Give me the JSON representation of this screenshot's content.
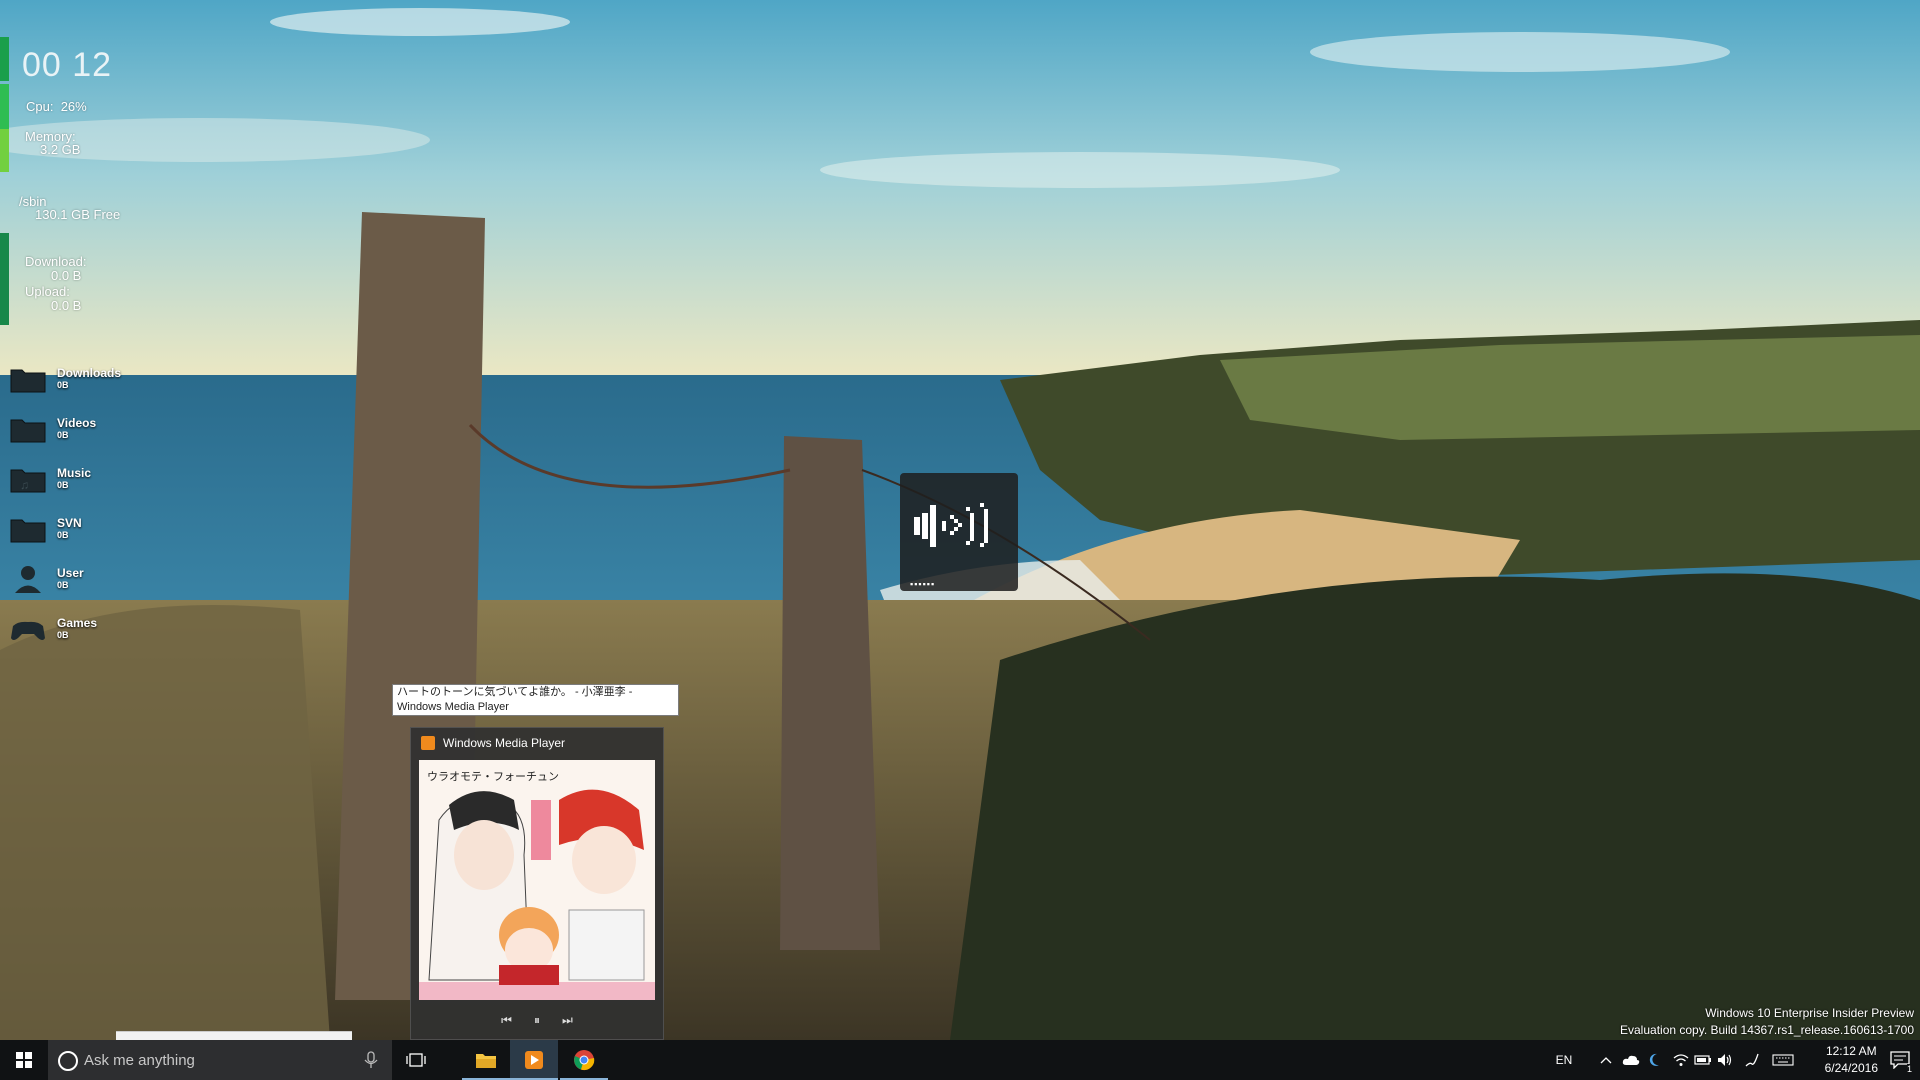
{
  "system": {
    "clock": "00 12",
    "cpu_label": "Cpu:",
    "cpu_value": "26%",
    "memory_label": "Memory:",
    "memory_value": "3.2 GB",
    "disk_label": "/sbin",
    "disk_value": "130.1 GB Free",
    "download_label": "Download:",
    "download_value": "0.0 B",
    "upload_label": "Upload:",
    "upload_value": "0.0 B",
    "accent_colors": [
      "#1a9f4b",
      "#2fbd52",
      "#72d03f"
    ]
  },
  "folders": [
    {
      "label": "Downloads",
      "size": "0B",
      "icon": "folder-icon"
    },
    {
      "label": "Videos",
      "size": "0B",
      "icon": "folder-icon"
    },
    {
      "label": "Music",
      "size": "0B",
      "icon": "folder-icon"
    },
    {
      "label": "SVN",
      "size": "0B",
      "icon": "folder-icon"
    },
    {
      "label": "User",
      "size": "0B",
      "icon": "user-icon"
    },
    {
      "label": "Games",
      "size": "0B",
      "icon": "gamepad-icon"
    }
  ],
  "volume_osd": {
    "icon": "speaker-volume-icon",
    "level_glyph": "▪▪▪▪▪▪"
  },
  "tooltip": {
    "text": "ハートのトーンに気づいてよ誰か。 - 小澤亜李 - Windows Media Player"
  },
  "media_flyout": {
    "title": "Windows Media Player",
    "album_title": "ウラオモテ・フォーチュン",
    "controls": {
      "previous": "⏮",
      "pause": "⏸",
      "next": "⏭"
    }
  },
  "watermark": {
    "line1": "Windows 10 Enterprise Insider Preview",
    "line2": "Evaluation copy. Build 14367.rs1_release.160613-1700"
  },
  "taskbar": {
    "search_placeholder": "Ask me anything",
    "language": "EN",
    "time": "12:12 AM",
    "date": "6/24/2016",
    "notification_count": "1"
  }
}
